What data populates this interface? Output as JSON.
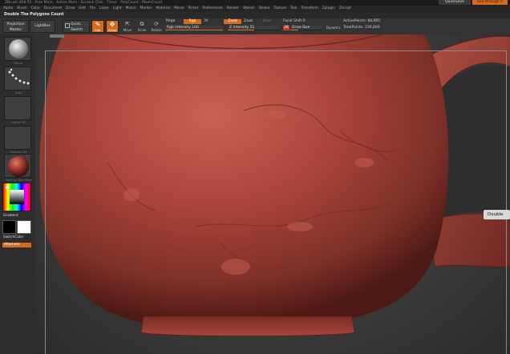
{
  "title_bar": {
    "text": "ZBrush 4R8 P2 · Free Mem · Active Mem · Scratch Disk · Timer · PolyCount · MeshCount",
    "quicksave_label": "QuickSave",
    "seethrough_label": "See-through 0"
  },
  "menu": {
    "items": [
      "Alpha",
      "Brush",
      "Color",
      "Document",
      "Draw",
      "Edit",
      "File",
      "Layer",
      "Light",
      "Macro",
      "Marker",
      "Material",
      "Movie",
      "Picker",
      "Preferences",
      "Render",
      "Stencil",
      "Stroke",
      "Texture",
      "Tool",
      "Transform",
      "Zplugin",
      "Zscript"
    ]
  },
  "doc": {
    "title": "Double  The Polygons Count"
  },
  "toolbar": {
    "projection_master": "Projection Master",
    "lightbox": "LightBox",
    "quick_sketch": "Quick Sketch",
    "edit": "Edit",
    "draw": "Draw",
    "move": "Move",
    "scale": "Scale",
    "rotate": "Rotate",
    "mrgb": "Mrgb",
    "rgb": "Rgb",
    "m": "M",
    "rgb_intensity": "Rgb Intensity 100",
    "rgb_intensity_value": 1.0,
    "zadd": "Zadd",
    "zsub": "Zsub",
    "zcut": "Zcut",
    "z_intensity": "Z Intensity 51",
    "z_intensity_value": 0.51,
    "focal_shift": "Focal Shift 0",
    "draw_size_num": "26",
    "draw_size": "Draw Size",
    "draw_size_value": 0.26,
    "dynamic": "Dynamic",
    "active_points": "ActivePoints: 88,985",
    "total_points": "TotalPoints: 236,800"
  },
  "left_tray": {
    "thumbs": [
      "Move",
      "Dots",
      "Alpha Off",
      "Texture Off",
      "MatCap Red Wax"
    ],
    "gradient": "Gradient",
    "switch_color": "SwitchColor",
    "alternate": "Alternate"
  },
  "tooltip": {
    "text": "Double"
  },
  "colors": {
    "accent": "#d86a1c",
    "clay_mid": "#a8443a",
    "clay_dark": "#6f2a23",
    "clay_light": "#c76255"
  }
}
